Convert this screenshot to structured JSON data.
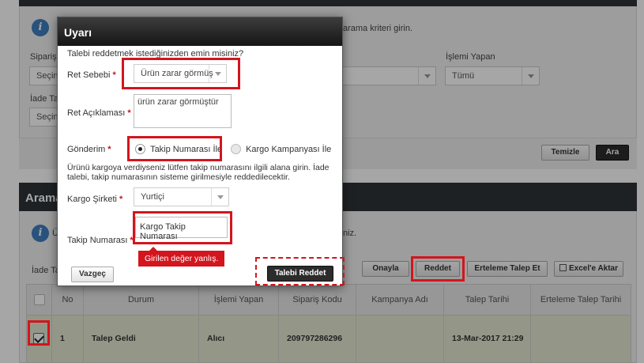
{
  "background": {
    "info_text": "arama kriteri girin.",
    "filters": {
      "siparis_label": "Sipariş",
      "siparis_value": "Seçin",
      "iade_label": "İade Ta",
      "iade_value": "Seçin",
      "islemi_yapan_label": "İşlemi Yapan",
      "islemi_yapan_value": "Tümü"
    },
    "buttons": {
      "temizle": "Temizle",
      "ara": "Ara"
    },
    "results": {
      "title": "Arama",
      "info_prefix": "Ü",
      "info_suffix": "niz.",
      "iade_label": "İade Ta",
      "actions": [
        "Onayla",
        "Reddet",
        "Erteleme Talep Et",
        "Excel'e Aktar"
      ],
      "columns": [
        "",
        "No",
        "Durum",
        "İşlemi Yapan",
        "Sipariş Kodu",
        "Kampanya Adı",
        "Talep Tarihi",
        "Erteleme Talep Tarihi"
      ],
      "rows": [
        {
          "checked": true,
          "no": "1",
          "durum": "Talep Geldi",
          "islemi_yapan": "Alıcı",
          "siparis_kodu": "209797286296",
          "kampanya_adi": "",
          "talep_tarihi": "13-Mar-2017 21:29",
          "erteleme_tarihi": ""
        }
      ]
    }
  },
  "modal": {
    "title": "Uyarı",
    "question": "Talebi reddetmek istediğinizden emin misiniz?",
    "ret_sebebi": {
      "label": "Ret Sebebi",
      "value": "Ürün zarar görmüş"
    },
    "ret_aciklamasi": {
      "label": "Ret Açıklaması",
      "value": "ürün zarar görmüştür"
    },
    "gonderim": {
      "label": "Gönderim",
      "options": [
        {
          "label": "Takip Numarası İle",
          "selected": true
        },
        {
          "label": "Kargo Kampanyası İle",
          "selected": false
        }
      ]
    },
    "hint": "Ürünü kargoya verdiyseniz lütfen takip numarasını ilgili alana girin. İade talebi, takip numarasının sisteme girilmesiyle reddedilecektir.",
    "kargo_sirketi": {
      "label": "Kargo Şirketi",
      "value": "Yurtiçi"
    },
    "takip_numarasi": {
      "label": "Takip Numarası",
      "value": "Kargo Takip Numarası"
    },
    "error": "Girilen değer yanlış.",
    "buttons": {
      "cancel": "Vazgeç",
      "confirm": "Talebi Reddet"
    },
    "required_mark": "*"
  },
  "colors": {
    "highlight": "#d3151d",
    "header_dark": "#2e3338",
    "selected_row": "#e3e8d0"
  }
}
